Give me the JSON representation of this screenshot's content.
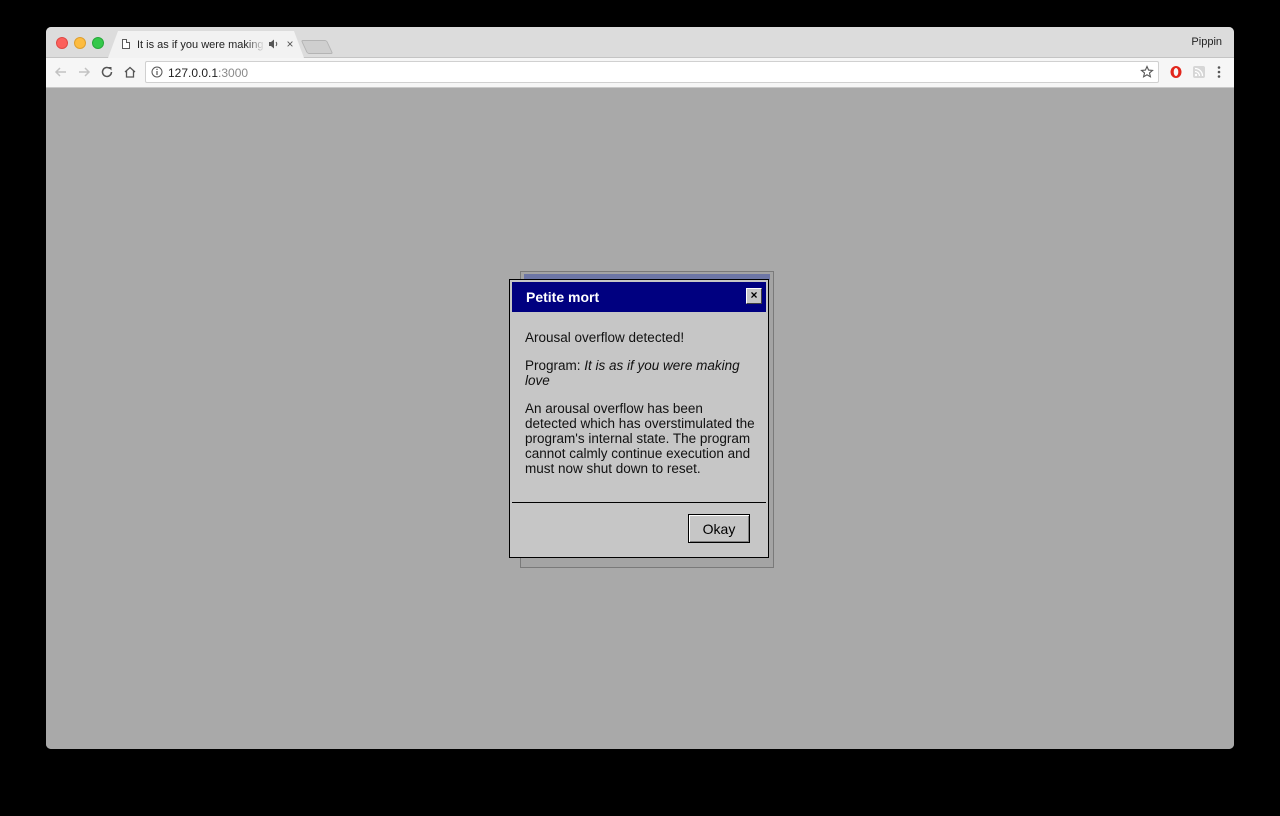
{
  "browser": {
    "tab": {
      "title": "It is as if you were making love",
      "close_glyph": "×"
    },
    "profile_name": "Pippin",
    "address": {
      "host": "127.0.0.1",
      "port": ":3000"
    },
    "icons": {
      "back": "arrow-left-icon",
      "forward": "arrow-right-icon",
      "reload": "reload-icon",
      "home": "home-icon",
      "info": "info-icon",
      "bookmark": "star-icon",
      "extension_opera": "opera-icon",
      "extension_rss": "rss-icon",
      "menu": "kebab-menu-icon"
    }
  },
  "dialog": {
    "title": "Petite mort",
    "close_glyph": "×",
    "heading": "Arousal overflow detected!",
    "program_label": "Program: ",
    "program_name": "It is as if you were making love",
    "message": "An arousal overflow has been detected which has overstimulated the program's internal state. The program cannot calmly continue execution and must now shut down to reset.",
    "ok_label": "Okay"
  },
  "colors": {
    "title_bar": "#000080",
    "dialog_bg": "#c6c6c6",
    "desktop_bg": "#a9a9a9"
  }
}
